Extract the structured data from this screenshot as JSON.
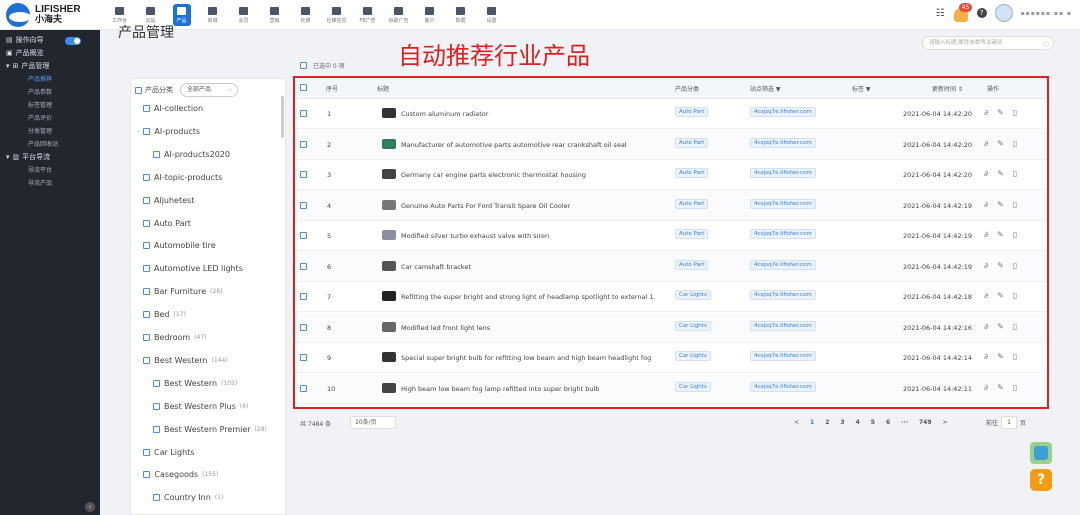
{
  "app": {
    "brand_en": "LIFISHER",
    "brand_cn": "小海夫"
  },
  "nav": [
    {
      "label": "工作台",
      "icon": "home-icon"
    },
    {
      "label": "云站",
      "icon": "monitor-icon"
    },
    {
      "label": "产品",
      "icon": "grid-icon",
      "active": true
    },
    {
      "label": "商城",
      "icon": "store-icon"
    },
    {
      "label": "会员",
      "icon": "crown-icon"
    },
    {
      "label": "营销",
      "icon": "chart-icon"
    },
    {
      "label": "社媒",
      "icon": "share-icon"
    },
    {
      "label": "社媒信息",
      "icon": "message-icon"
    },
    {
      "label": "FB广告",
      "icon": "facebook-icon"
    },
    {
      "label": "谷歌广告",
      "icon": "google-icon"
    },
    {
      "label": "客户",
      "icon": "user-icon"
    },
    {
      "label": "数据",
      "icon": "pie-icon"
    },
    {
      "label": "设置",
      "icon": "settings-icon"
    }
  ],
  "header": {
    "notification_count": "45",
    "help": "?"
  },
  "sidebar": {
    "groups": [
      {
        "label": "操作向导",
        "toggle": true
      },
      {
        "label": "产品概览"
      },
      {
        "label": "产品管理",
        "children": [
          "产品推荐",
          "产品参数",
          "标签管理",
          "产品评价",
          "分类管理",
          "产品回收站"
        ]
      },
      {
        "label": "平台导流",
        "children": [
          "导流平台",
          "导流产品"
        ]
      }
    ]
  },
  "page": {
    "title": "产品管理",
    "overlay_title": "自动推荐行业产品",
    "search_placeholder": "请输入标题/属性参数等关键词"
  },
  "tree": {
    "filter_label": "产品分类",
    "select_value": "全部产品",
    "items": [
      {
        "label": "AI-collection",
        "count": ""
      },
      {
        "label": "AI-products",
        "count": "",
        "expandable": true
      },
      {
        "label": "AI-products2020",
        "count": "",
        "indent": true
      },
      {
        "label": "AI-topic-products",
        "count": ""
      },
      {
        "label": "Aljuhetest",
        "count": ""
      },
      {
        "label": "Auto Part",
        "count": ""
      },
      {
        "label": "Automobile tire",
        "count": ""
      },
      {
        "label": "Automotive LED lights",
        "count": ""
      },
      {
        "label": "Bar Furniture",
        "count": "(28)"
      },
      {
        "label": "Bed",
        "count": "(17)"
      },
      {
        "label": "Bedroom",
        "count": "(47)"
      },
      {
        "label": "Best Western",
        "count": "(144)",
        "expandable": true
      },
      {
        "label": "Best Western",
        "count": "(105)",
        "indent": true
      },
      {
        "label": "Best Western Plus",
        "count": "(6)",
        "indent": true
      },
      {
        "label": "Best Western Premier",
        "count": "(28)",
        "indent": true
      },
      {
        "label": "Car Lights",
        "count": ""
      },
      {
        "label": "Casegoods",
        "count": "(155)",
        "expandable": true
      },
      {
        "label": "Country Inn",
        "count": "(1)",
        "indent": true
      }
    ]
  },
  "table": {
    "selected_text": "已选中 0 项",
    "columns": {
      "index": "序号",
      "title": "标题",
      "category": "产品分类",
      "site": "站点筛选",
      "tag": "标签",
      "updated": "更新时间",
      "ops": "操作"
    },
    "rows": [
      {
        "index": "1",
        "title": "Custom aluminum radiator",
        "category": "Auto Part",
        "site": "4cxjsq7e.lifisher.com",
        "updated": "2021-06-04 14:42:20"
      },
      {
        "index": "2",
        "title": "Manufacturer of automotive parts automotive rear crankshaft oil seal",
        "category": "Auto Part",
        "site": "4cxjsq7e.lifisher.com",
        "updated": "2021-06-04 14:42:20"
      },
      {
        "index": "3",
        "title": "Germany car engine parts electronic thermostat housing",
        "category": "Auto Part",
        "site": "4cxjsq7e.lifisher.com",
        "updated": "2021-06-04 14:42:20"
      },
      {
        "index": "4",
        "title": "Genuine Auto Parts For Ford Transit Spare Oil Cooler",
        "category": "Auto Part",
        "site": "4cxjsq7e.lifisher.com",
        "updated": "2021-06-04 14:42:19"
      },
      {
        "index": "5",
        "title": "Modified silver turbo exhaust valve with siren",
        "category": "Auto Part",
        "site": "4cxjsq7e.lifisher.com",
        "updated": "2021-06-04 14:42:19"
      },
      {
        "index": "6",
        "title": "Car camshaft bracket",
        "category": "Auto Part",
        "site": "4cxjsq7e.lifisher.com",
        "updated": "2021-06-04 14:42:19"
      },
      {
        "index": "7",
        "title": "Refitting the super bright and strong light of headlamp spotlight to external 1.",
        "category": "Car Lights",
        "site": "4cxjsq7e.lifisher.com",
        "updated": "2021-06-04 14:42:18"
      },
      {
        "index": "8",
        "title": "Modified led front light lens",
        "category": "Car Lights",
        "site": "4cxjsq7e.lifisher.com",
        "updated": "2021-06-04 14:42:16"
      },
      {
        "index": "9",
        "title": "Special super bright bulb for refitting low beam and high beam headlight fog",
        "category": "Car Lights",
        "site": "4cxjsq7e.lifisher.com",
        "updated": "2021-06-04 14:42:14"
      },
      {
        "index": "10",
        "title": "High beam low beam fog lamp refitted into super bright bulb",
        "category": "Car Lights",
        "site": "4cxjsq7e.lifisher.com",
        "updated": "2021-06-04 14:42:11"
      }
    ]
  },
  "pager": {
    "total": "共 7484 条",
    "page_size": "10条/页",
    "pages": [
      "<",
      "1",
      "2",
      "3",
      "4",
      "5",
      "6",
      "···",
      "749",
      ">"
    ],
    "current": "1",
    "goto_label": "前往",
    "goto_value": "1",
    "goto_suffix": "页"
  }
}
